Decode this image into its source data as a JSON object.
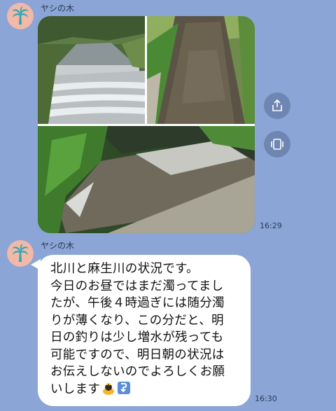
{
  "messages": [
    {
      "sender": "ヤシの木",
      "time": "16:29",
      "type": "photos",
      "photo_count": 3
    },
    {
      "sender": "ヤシの木",
      "time": "16:30",
      "type": "text",
      "lines": [
        "北川と麻生川の状況です。",
        "今日のお昼ではまだ濁ってまし",
        "たが、午後４時過ぎには随分濁",
        "りが薄くなり、この分だと、明",
        "日の釣りは少し増水が残っても",
        "可能ですので、明日朝の状況は",
        "お伝えしないのでよろしくお願",
        "いします"
      ],
      "emojis": [
        "person-bowing-emoji",
        "down-arrow-emoji"
      ]
    }
  ],
  "side_buttons": [
    "share-icon",
    "album-icon"
  ],
  "colors": {
    "background": "#8aa5d6",
    "bubble": "#ffffff",
    "avatar": "#f2b8a8",
    "palm": "#2aa7b0"
  }
}
